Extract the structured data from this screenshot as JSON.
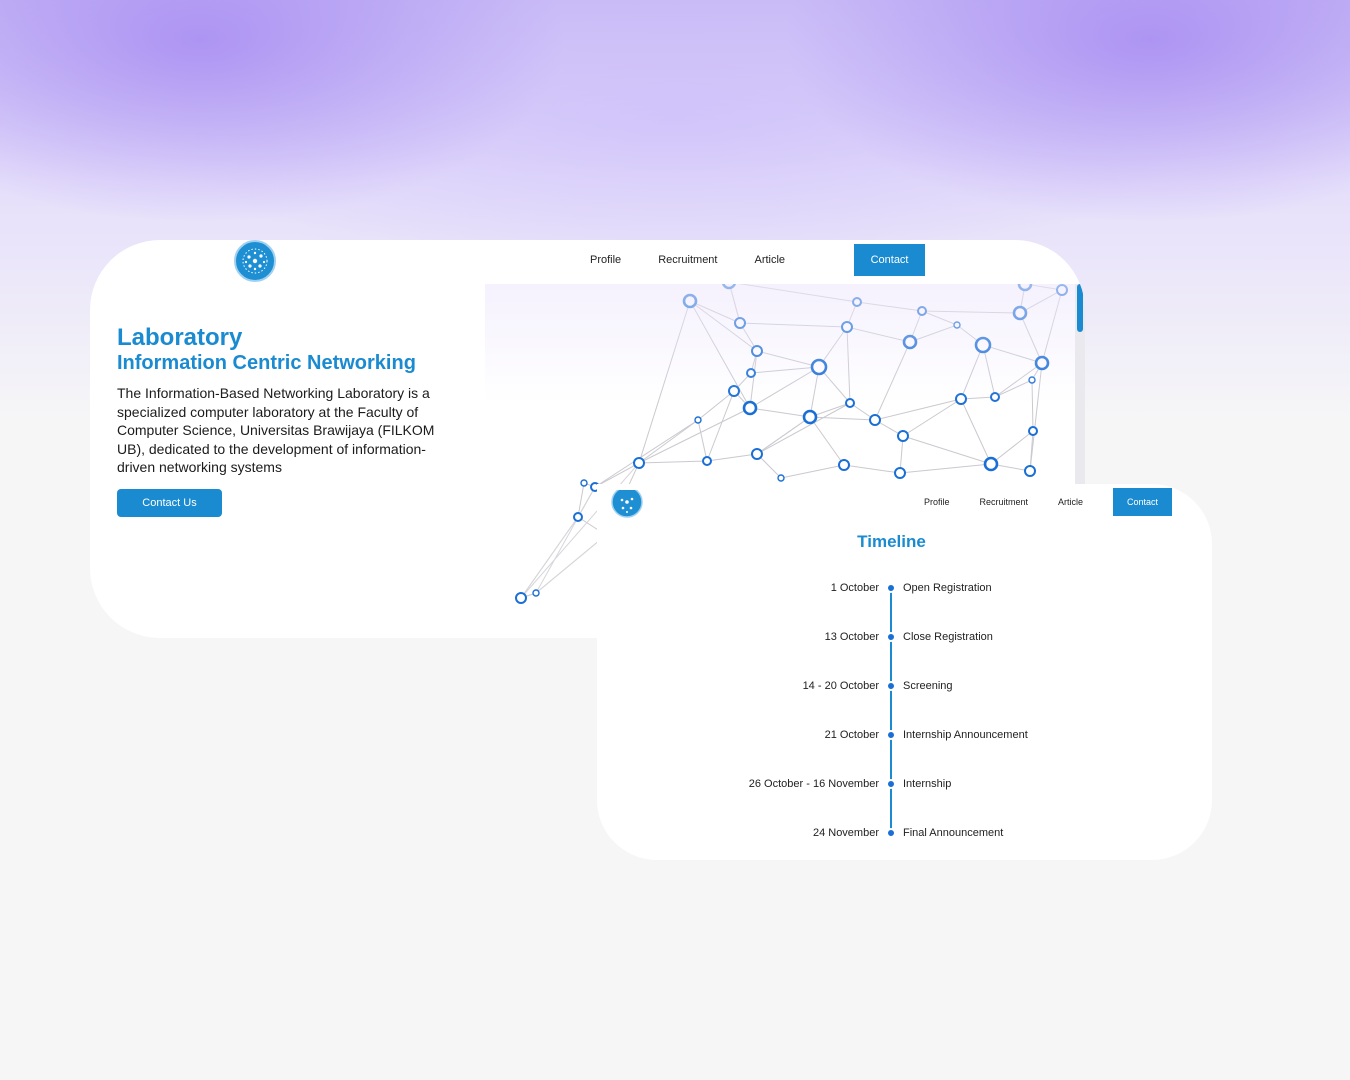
{
  "hero_section": {
    "nav": {
      "items": [
        "Profile",
        "Recruitment",
        "Article"
      ],
      "cta": "Contact"
    },
    "title": "Laboratory",
    "subtitle": "Information Centric Networking",
    "description": "The Information-Based Networking Laboratory is a specialized computer laboratory at the Faculty of Computer Science, Universitas Brawijaya (FILKOM UB), dedicated to the development of information-driven networking systems",
    "button": "Contact Us"
  },
  "timeline_section": {
    "nav": {
      "items": [
        "Profile",
        "Recruitment",
        "Article"
      ],
      "cta": "Contact"
    },
    "title": "Timeline",
    "events": [
      {
        "date": "1 October",
        "event": "Open Registration"
      },
      {
        "date": "13 October",
        "event": "Close Registration"
      },
      {
        "date": "14 - 20 October",
        "event": "Screening"
      },
      {
        "date": "21 October",
        "event": "Internship Announcement"
      },
      {
        "date": "26 October - 16 November",
        "event": "Internship"
      },
      {
        "date": "24 November",
        "event": "Final Announcement"
      }
    ]
  },
  "colors": {
    "accent": "#1a8bd0",
    "node": "#1a6fd6",
    "background_glow": "#a78cf2"
  },
  "icons": {
    "logo": "lab-logo-icon",
    "network_graphic": "network-graph-decoration"
  }
}
